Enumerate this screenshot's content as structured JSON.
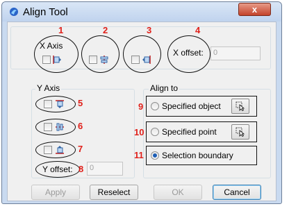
{
  "window": {
    "title": "Align Tool",
    "close_label": "x"
  },
  "x_axis": {
    "label": "X Axis",
    "offset_label": "X offset:",
    "offset_value": "0"
  },
  "y_axis": {
    "label": "Y Axis",
    "offset_label": "Y offset:",
    "offset_value": "0"
  },
  "align_to": {
    "label": "Align to",
    "options": [
      {
        "label": "Specified object",
        "selected": false
      },
      {
        "label": "Specified point",
        "selected": false
      },
      {
        "label": "Selection boundary",
        "selected": true
      }
    ]
  },
  "annotations": [
    "1",
    "2",
    "3",
    "4",
    "5",
    "6",
    "7",
    "8",
    "9",
    "10",
    "11"
  ],
  "buttons": {
    "apply": "Apply",
    "reselect": "Reselect",
    "ok": "OK",
    "cancel": "Cancel"
  },
  "colors": {
    "annotation": "#e0201a",
    "accent": "#1d5eb5",
    "titlebar": "#c9daf0",
    "close": "#c4432b"
  }
}
